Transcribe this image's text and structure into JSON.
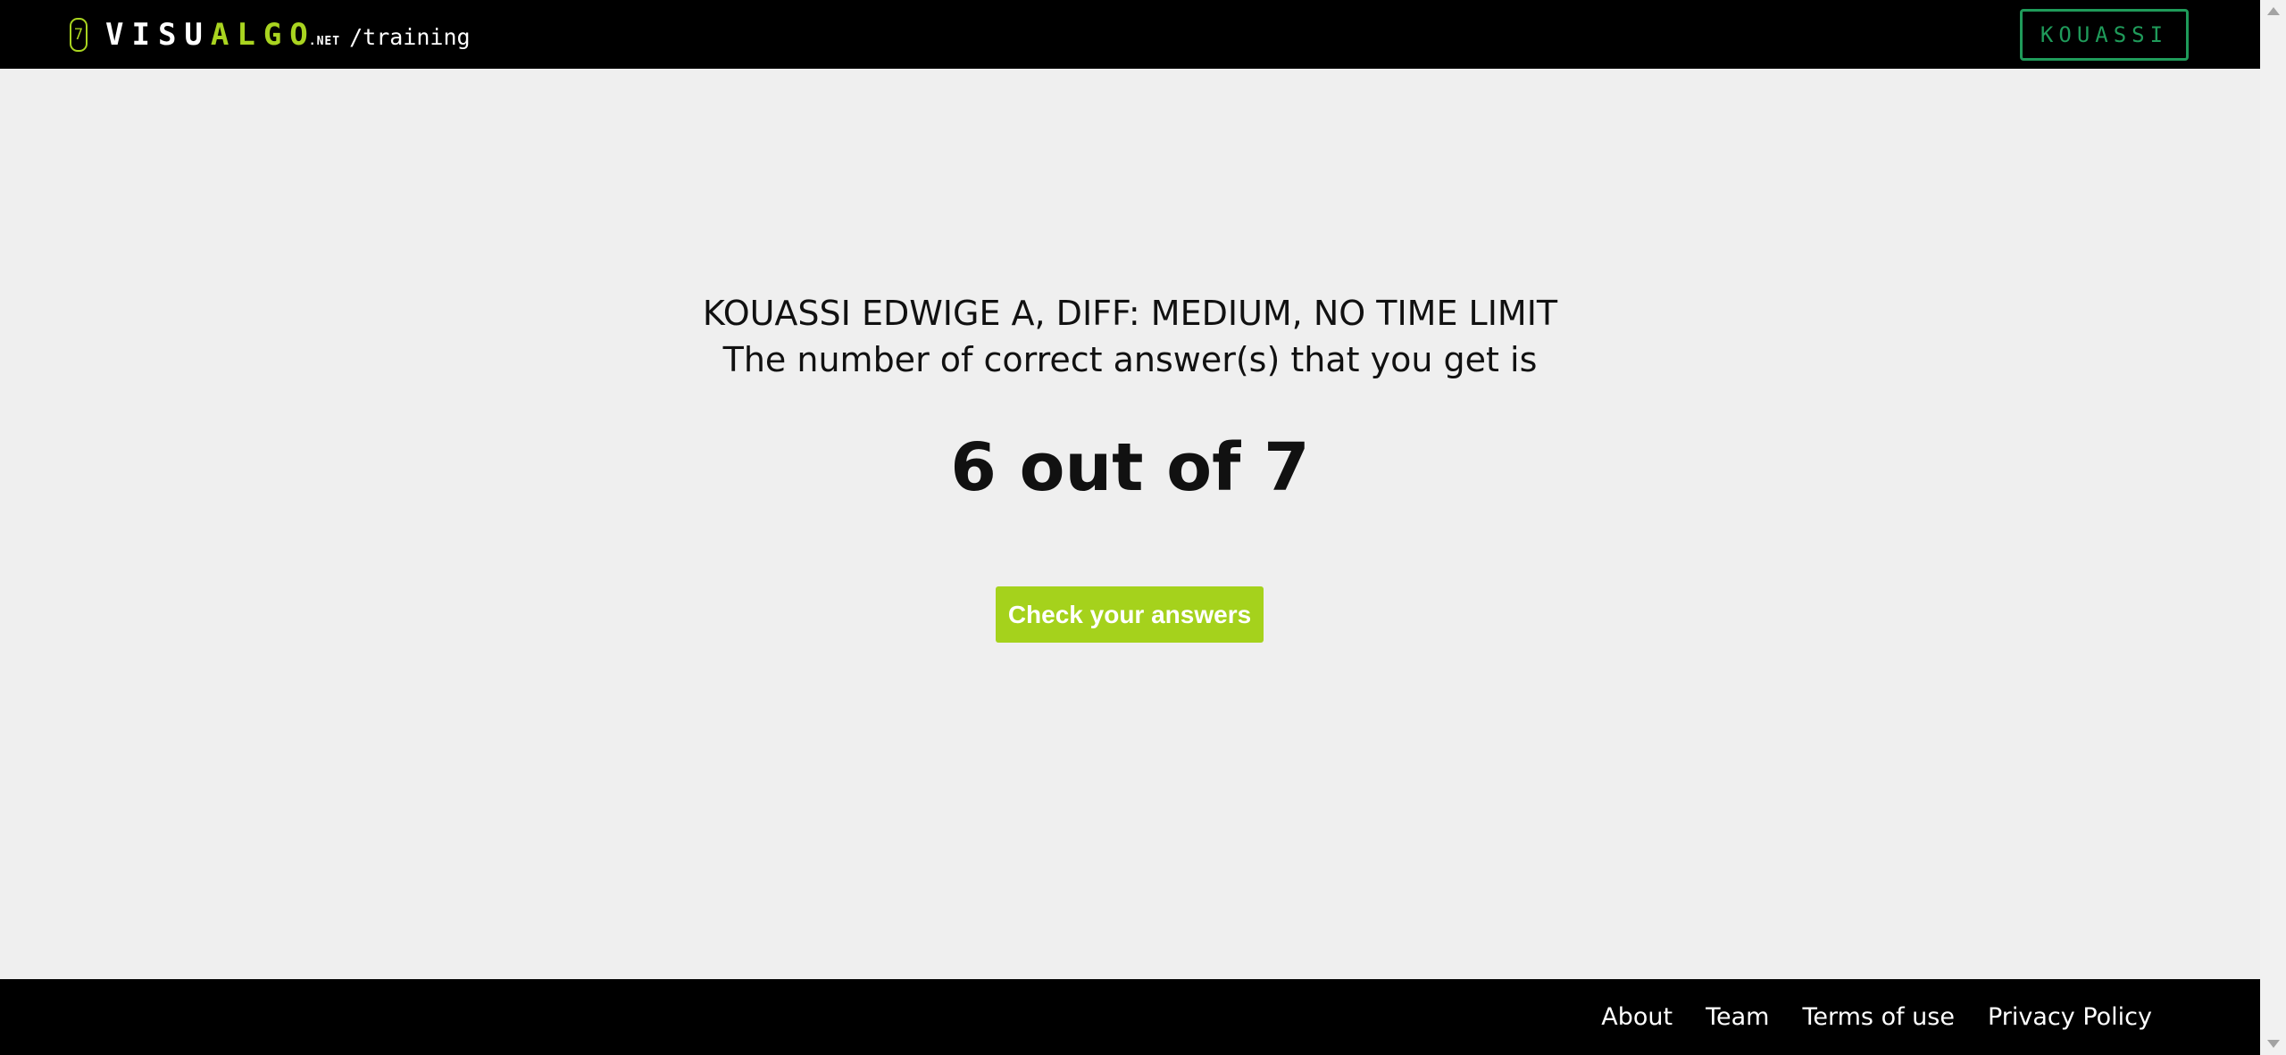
{
  "header": {
    "logo_badge": "7",
    "logo_word_white": "VISU",
    "logo_word_green": "ALGO",
    "logo_suffix": ".NET",
    "path": "/training",
    "user_button": "KOUASSI"
  },
  "result": {
    "summary_line": "KOUASSI EDWIGE A, DIFF: MEDIUM, NO TIME LIMIT",
    "subtitle": "The number of correct answer(s) that you get is",
    "score_text": "6 out of 7",
    "check_button": "Check your answers"
  },
  "footer": {
    "links": [
      "About",
      "Team",
      "Terms of use",
      "Privacy Policy"
    ]
  },
  "colors": {
    "accent_green": "#a9d420",
    "user_button_green": "#1f9b5a",
    "header_bg": "#000000",
    "page_bg": "#efefef"
  }
}
